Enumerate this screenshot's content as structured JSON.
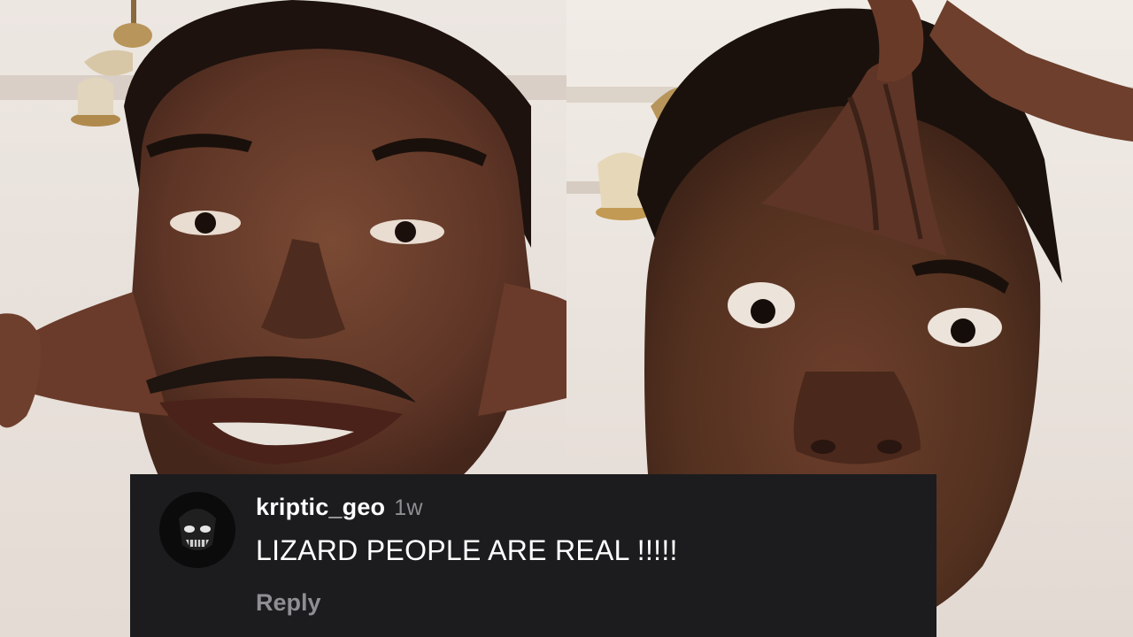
{
  "comment": {
    "username": "kriptic_geo",
    "timestamp": "1w",
    "text": "LIZARD PEOPLE ARE REAL !!!!!",
    "reply_label": "Reply",
    "avatar_icon": "skull-avatar-icon"
  },
  "colors": {
    "card_background": "#1c1c1e",
    "primary_text": "#ffffff",
    "secondary_text": "#8e8e93"
  },
  "media": {
    "left_panel": "person-stretching-cheeks-photo",
    "right_panel": "person-stretching-forehead-photo"
  }
}
